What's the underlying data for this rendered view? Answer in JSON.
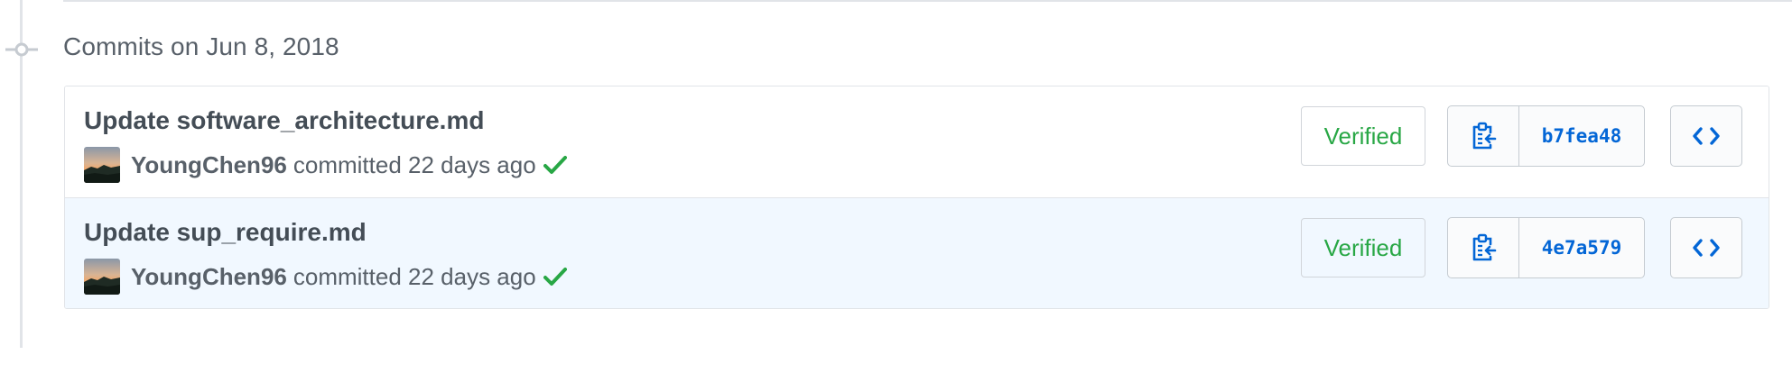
{
  "group": {
    "title": "Commits on Jun 8, 2018"
  },
  "commits": [
    {
      "title": "Update software_architecture.md",
      "author": "YoungChen96",
      "action": "committed",
      "time": "22 days ago",
      "status_icon": "check-icon",
      "verified_label": "Verified",
      "sha": "b7fea48",
      "copy_icon": "clippy-icon",
      "browse_icon": "code-icon"
    },
    {
      "title": "Update sup_require.md",
      "author": "YoungChen96",
      "action": "committed",
      "time": "22 days ago",
      "status_icon": "check-icon",
      "verified_label": "Verified",
      "sha": "4e7a579",
      "copy_icon": "clippy-icon",
      "browse_icon": "code-icon"
    }
  ],
  "colors": {
    "link_blue": "#0366d6",
    "success_green": "#28a745",
    "row_highlight": "#f1f8ff",
    "border": "#e1e4e8"
  }
}
